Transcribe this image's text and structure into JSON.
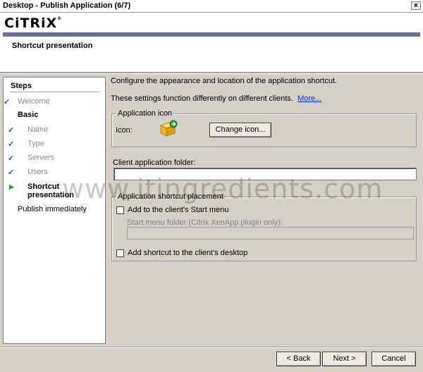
{
  "window": {
    "title": "Desktop - Publish Application (6/7)",
    "close_glyph": "×"
  },
  "header": {
    "logo_text": "CiTRiX",
    "logo_mark": "®",
    "subtitle": "Shortcut presentation",
    "accent_color": "#6d6e9b"
  },
  "steps": {
    "title": "Steps",
    "items": [
      {
        "label": "Welcome",
        "state": "done"
      },
      {
        "label": "Basic",
        "state": "section"
      },
      {
        "label": "Name",
        "state": "done"
      },
      {
        "label": "Type",
        "state": "done"
      },
      {
        "label": "Servers",
        "state": "done"
      },
      {
        "label": "Users",
        "state": "done"
      },
      {
        "label": "Shortcut presentation",
        "state": "current"
      },
      {
        "label": "Publish immediately",
        "state": "pending"
      }
    ],
    "check_glyph": "✓",
    "current_glyph": "▶"
  },
  "main": {
    "intro": "Configure the appearance and location of the application shortcut.",
    "note": "These settings function differently on different clients.",
    "more_link": "More...",
    "app_icon_group": {
      "legend": "Application icon",
      "icon_label": "Icon:",
      "icon_name": "application-package-icon",
      "change_button": "Change icon..."
    },
    "client_folder": {
      "label": "Client application folder:",
      "value": ""
    },
    "placement_group": {
      "legend": "Application shortcut placement",
      "start_menu_checkbox": "Add to the client's Start menu",
      "start_menu_checked": false,
      "start_menu_folder_label": "Start menu folder (Citrix XenApp plugin only):",
      "start_menu_folder_value": "",
      "desktop_checkbox": "Add shortcut to the client's desktop",
      "desktop_checked": false
    }
  },
  "footer": {
    "back": "< Back",
    "next": "Next >",
    "cancel": "Cancel"
  },
  "watermark": "www.itingredients.com"
}
